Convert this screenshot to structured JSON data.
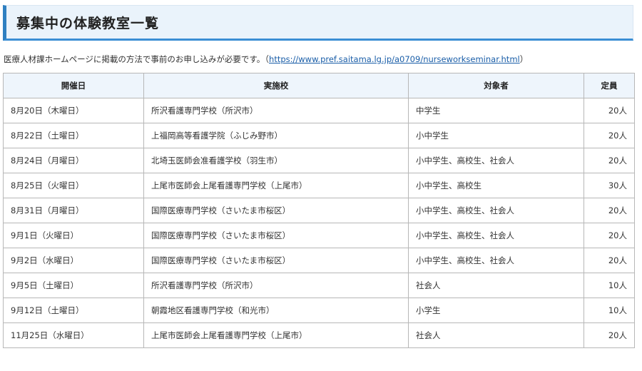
{
  "heading": "募集中の体験教室一覧",
  "intro": {
    "text_before": "医療人材課ホームページに掲載の方法で事前のお申し込みが必要です。（",
    "link_text": "https://www.pref.saitama.lg.jp/a0709/nurseworkseminar.html",
    "text_after": "）"
  },
  "table": {
    "headers": [
      "開催日",
      "実施校",
      "対象者",
      "定員"
    ],
    "rows": [
      [
        "8月20日（木曜日）",
        "所沢看護専門学校（所沢市）",
        "中学生",
        "20人"
      ],
      [
        "8月22日（土曜日）",
        "上福岡高等看護学院（ふじみ野市）",
        "小中学生",
        "20人"
      ],
      [
        "8月24日（月曜日）",
        "北埼玉医師会准看護学校（羽生市）",
        "小中学生、高校生、社会人",
        "20人"
      ],
      [
        "8月25日（火曜日）",
        "上尾市医師会上尾看護専門学校（上尾市）",
        "小中学生、高校生",
        "30人"
      ],
      [
        "8月31日（月曜日）",
        "国際医療専門学校（さいたま市桜区）",
        "小中学生、高校生、社会人",
        "20人"
      ],
      [
        "9月1日（火曜日）",
        "国際医療専門学校（さいたま市桜区）",
        "小中学生、高校生、社会人",
        "20人"
      ],
      [
        "9月2日（水曜日）",
        "国際医療専門学校（さいたま市桜区）",
        "小中学生、高校生、社会人",
        "20人"
      ],
      [
        "9月5日（土曜日）",
        "所沢看護専門学校（所沢市）",
        "社会人",
        "10人"
      ],
      [
        "9月12日（土曜日）",
        "朝霞地区看護専門学校（和光市）",
        "小学生",
        "10人"
      ],
      [
        "11月25日（水曜日）",
        "上尾市医師会上尾看護専門学校（上尾市）",
        "社会人",
        "20人"
      ]
    ]
  }
}
